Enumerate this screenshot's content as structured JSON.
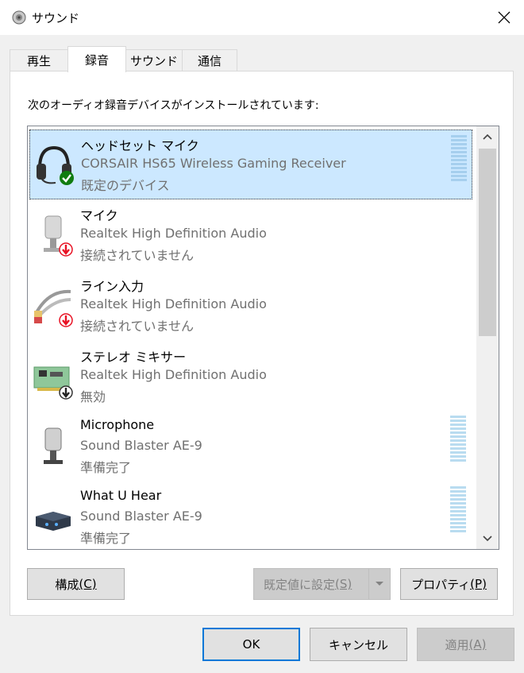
{
  "window": {
    "title": "サウンド"
  },
  "tabs": [
    {
      "label": "再生"
    },
    {
      "label": "録音"
    },
    {
      "label": "サウンド"
    },
    {
      "label": "通信"
    }
  ],
  "panel": {
    "instructions": "次のオーディオ録音デバイスがインストールされています:"
  },
  "devices": [
    {
      "name": "ヘッドセット マイク",
      "driver": "CORSAIR HS65 Wireless Gaming Receiver",
      "status": "既定のデバイス",
      "icon": "headset-icon",
      "badge": "default-check"
    },
    {
      "name": "マイク",
      "driver": "Realtek High Definition Audio",
      "status": "接続されていません",
      "icon": "microphone-icon",
      "badge": "unplugged-arrow"
    },
    {
      "name": "ライン入力",
      "driver": "Realtek High Definition Audio",
      "status": "接続されていません",
      "icon": "line-in-cable-icon",
      "badge": "unplugged-arrow"
    },
    {
      "name": "ステレオ ミキサー",
      "driver": "Realtek High Definition Audio",
      "status": "無効",
      "icon": "sound-card-icon",
      "badge": "disabled-arrow"
    },
    {
      "name": "Microphone",
      "driver": "Sound Blaster AE-9",
      "status": "準備完了",
      "icon": "microphone-icon",
      "badge": "none"
    },
    {
      "name": "What U Hear",
      "driver": "Sound Blaster AE-9",
      "status": "準備完了",
      "icon": "audio-device-icon",
      "badge": "none"
    }
  ],
  "buttons": {
    "configure": {
      "label": "構成",
      "accel": "(C)"
    },
    "set_default": {
      "label": "既定値に設定",
      "accel": "(S)"
    },
    "properties": {
      "label": "プロパティ",
      "accel": "(P)"
    },
    "ok": {
      "label": "OK"
    },
    "cancel": {
      "label": "キャンセル"
    },
    "apply": {
      "label": "適用",
      "accel": "(A)"
    }
  },
  "colors": {
    "selection": "#cce8ff",
    "accent": "#0078d7",
    "check": "#107c10",
    "badge_red": "#e81123"
  }
}
